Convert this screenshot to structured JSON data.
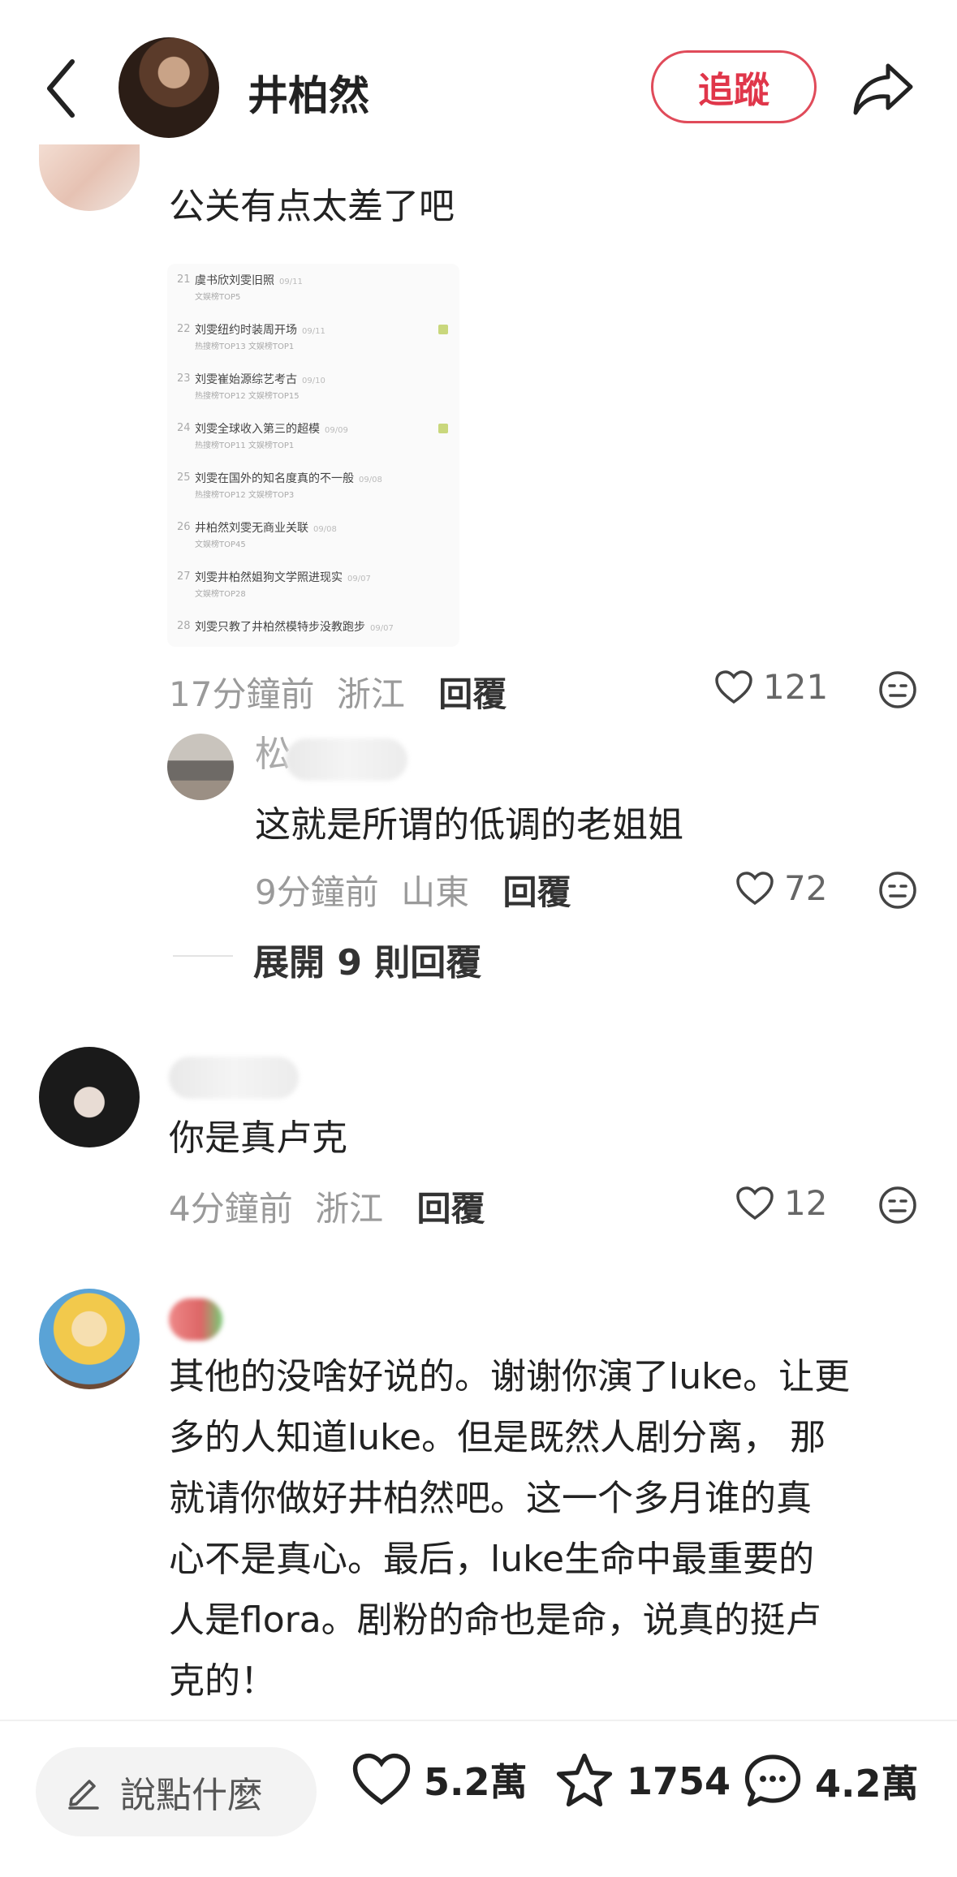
{
  "header": {
    "author_name": "井柏然",
    "follow_label": "追蹤"
  },
  "comments": [
    {
      "text": "公关有点太差了吧",
      "image_rows": [
        {
          "rank": "21",
          "title": "虞书欣刘雯旧照",
          "date": "09/11",
          "sub": "文娱榜TOP5"
        },
        {
          "rank": "22",
          "title": "刘雯纽约时装周开场",
          "date": "09/11",
          "sub": "热搜榜TOP13   文娱榜TOP1"
        },
        {
          "rank": "23",
          "title": "刘雯崔始源综艺考古",
          "date": "09/10",
          "sub": "热搜榜TOP12   文娱榜TOP15"
        },
        {
          "rank": "24",
          "title": "刘雯全球收入第三的超模",
          "date": "09/09",
          "sub": "热搜榜TOP11   文娱榜TOP1"
        },
        {
          "rank": "25",
          "title": "刘雯在国外的知名度真的不一般",
          "date": "09/08",
          "sub": "热搜榜TOP12   文娱榜TOP3"
        },
        {
          "rank": "26",
          "title": "井柏然刘雯无商业关联",
          "date": "09/08",
          "sub": "文娱榜TOP45"
        },
        {
          "rank": "27",
          "title": "刘雯井柏然姐狗文学照进现实",
          "date": "09/07",
          "sub": "文娱榜TOP28"
        },
        {
          "rank": "28",
          "title": "刘雯只教了井柏然模特步没教跑步",
          "date": "09/07",
          "sub": ""
        }
      ],
      "time": "17分鐘前",
      "location": "浙江",
      "reply_label": "回覆",
      "likes": "121"
    },
    {
      "name_visible": "松",
      "text": "这就是所谓的低调的老姐姐",
      "time": "9分鐘前",
      "location": "山東",
      "reply_label": "回覆",
      "likes": "72"
    },
    {
      "text": "你是真卢克",
      "time": "4分鐘前",
      "location": "浙江",
      "reply_label": "回覆",
      "likes": "12"
    },
    {
      "text_lines": [
        "其他的没啥好说的。谢谢你演了luke。让更",
        "多的人知道luke。但是既然人剧分离，  那",
        "就请你做好井柏然吧。这一个多月谁的真",
        "心不是真心。最后，luke生命中最重要的",
        "人是flora。剧粉的命也是命，说真的挺卢",
        "克的！"
      ]
    }
  ],
  "expand_replies_label": "展開 9 則回覆",
  "bottom_bar": {
    "input_placeholder": "說點什麼",
    "likes": "5.2萬",
    "favorites": "1754",
    "comments": "4.2萬"
  },
  "icons": {
    "back": "chevron-left-icon",
    "share": "share-arrow-icon",
    "like": "heart-outline-icon",
    "dislike": "dislike-face-icon",
    "edit": "pencil-icon",
    "star": "star-outline-icon",
    "comment": "comment-bubble-icon"
  },
  "colors": {
    "accent": "#e0364a",
    "meta_text": "#9a9a9a"
  }
}
